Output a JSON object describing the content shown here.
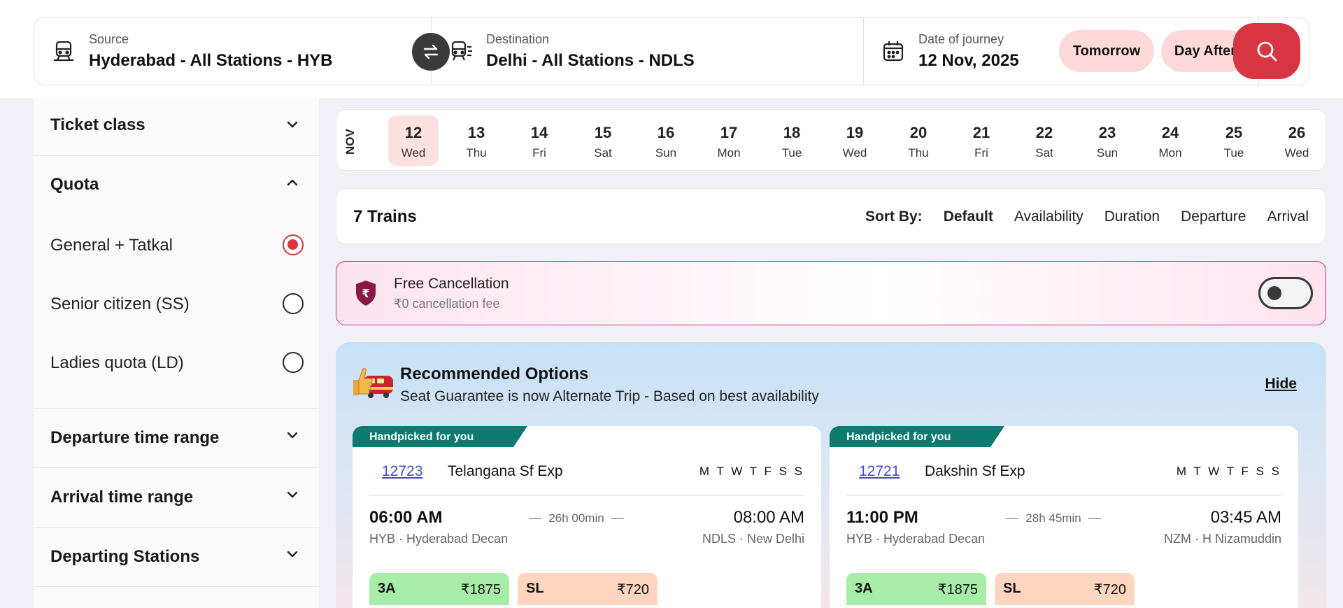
{
  "search": {
    "source_label": "Source",
    "source_value": "Hyderabad - All Stations - HYB",
    "dest_label": "Destination",
    "dest_value": "Delhi - All Stations - NDLS",
    "date_label": "Date of journey",
    "date_value": "12 Nov, 2025",
    "tomorrow_label": "Tomorrow",
    "dayafter_label": "Day After",
    "icons": [
      "train-icon",
      "swap-icon",
      "train-running-icon",
      "calendar-icon",
      "search-icon"
    ],
    "accent_color": "#d63541"
  },
  "sidebar": {
    "ticket_class": "Ticket class",
    "quota": "Quota",
    "quota_options": [
      {
        "label": "General + Tatkal",
        "selected": true
      },
      {
        "label": "Senior citizen (SS)",
        "selected": false
      },
      {
        "label": "Ladies quota (LD)",
        "selected": false
      }
    ],
    "departure_range": "Departure time range",
    "arrival_range": "Arrival time range",
    "departing_stations": "Departing Stations"
  },
  "dates": {
    "month": "NOV",
    "days": [
      {
        "num": "12",
        "name": "Wed",
        "selected": true
      },
      {
        "num": "13",
        "name": "Thu"
      },
      {
        "num": "14",
        "name": "Fri"
      },
      {
        "num": "15",
        "name": "Sat"
      },
      {
        "num": "16",
        "name": "Sun"
      },
      {
        "num": "17",
        "name": "Mon"
      },
      {
        "num": "18",
        "name": "Tue"
      },
      {
        "num": "19",
        "name": "Wed"
      },
      {
        "num": "20",
        "name": "Thu"
      },
      {
        "num": "21",
        "name": "Fri"
      },
      {
        "num": "22",
        "name": "Sat"
      },
      {
        "num": "23",
        "name": "Sun"
      },
      {
        "num": "24",
        "name": "Mon"
      },
      {
        "num": "25",
        "name": "Tue"
      },
      {
        "num": "26",
        "name": "Wed"
      }
    ]
  },
  "results": {
    "count": "7 Trains",
    "sort_label": "Sort By:",
    "sort_options": [
      "Default",
      "Availability",
      "Duration",
      "Departure",
      "Arrival"
    ],
    "sort_active": "Default"
  },
  "cancellation": {
    "title": "Free Cancellation",
    "subtitle": "₹0 cancellation fee",
    "enabled": false,
    "border_color": "#c72e86"
  },
  "recommended": {
    "title": "Recommended Options",
    "subtitle": "Seat Guarantee is now Alternate Trip - Based on best availability",
    "hide_label": "Hide",
    "cards": [
      {
        "tag": "Handpicked for you",
        "number": "12723",
        "name": "Telangana Sf Exp",
        "days": "M T W T F S S",
        "dep_time": "06:00 AM",
        "duration": "26h 00min",
        "arr_time": "08:00 AM",
        "dep_station": "HYB · Hyderabad Decan",
        "arr_station": "NDLS · New Delhi",
        "fares": [
          {
            "cls": "3A",
            "price": "₹1875"
          },
          {
            "cls": "SL",
            "price": "₹720"
          }
        ]
      },
      {
        "tag": "Handpicked for you",
        "number": "12721",
        "name": "Dakshin Sf Exp",
        "days": "M T W T F S S",
        "dep_time": "11:00 PM",
        "duration": "28h 45min",
        "arr_time": "03:45 AM",
        "dep_station": "HYB · Hyderabad Decan",
        "arr_station": "NZM · H Nizamuddin",
        "fares": [
          {
            "cls": "3A",
            "price": "₹1875"
          },
          {
            "cls": "SL",
            "price": "₹720"
          }
        ]
      }
    ]
  }
}
